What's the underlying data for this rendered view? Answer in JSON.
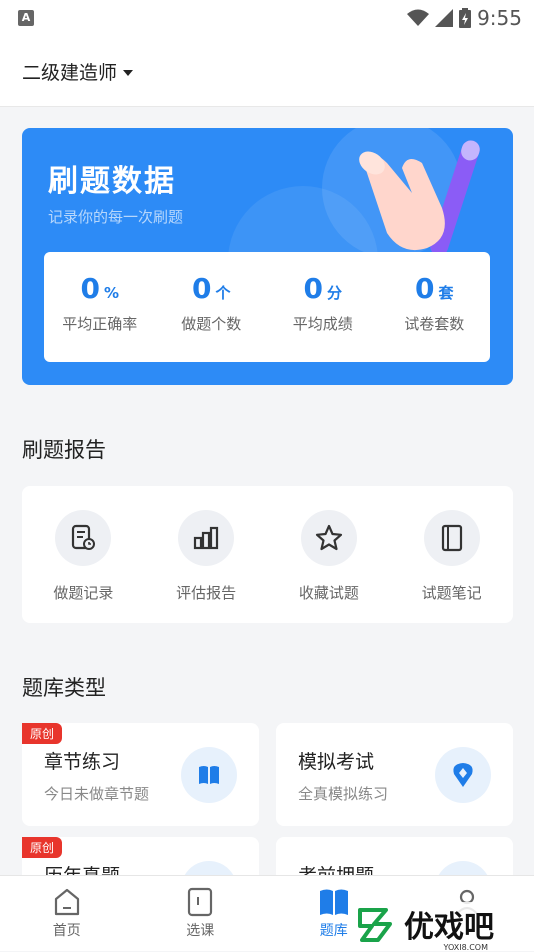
{
  "status_bar": {
    "time": "9:55",
    "left_badge": "A"
  },
  "header": {
    "subject": "二级建造师"
  },
  "banner": {
    "title": "刷题数据",
    "subtitle": "记录你的每一次刷题",
    "stats": [
      {
        "value": "0",
        "unit": "%",
        "label": "平均正确率"
      },
      {
        "value": "0",
        "unit": "个",
        "label": "做题个数"
      },
      {
        "value": "0",
        "unit": "分",
        "label": "平均成绩"
      },
      {
        "value": "0",
        "unit": "套",
        "label": "试卷套数"
      }
    ]
  },
  "report": {
    "title": "刷题报告",
    "items": [
      {
        "label": "做题记录",
        "icon": "record-icon"
      },
      {
        "label": "评估报告",
        "icon": "bar-chart-icon"
      },
      {
        "label": "收藏试题",
        "icon": "star-icon"
      },
      {
        "label": "试题笔记",
        "icon": "notebook-icon"
      }
    ]
  },
  "bank": {
    "title": "题库类型",
    "cards": [
      {
        "tag": "原创",
        "title": "章节练习",
        "subtitle": "今日未做章节题",
        "icon": "book-icon"
      },
      {
        "tag": "",
        "title": "模拟考试",
        "subtitle": "全真模拟练习",
        "icon": "location-pin-icon"
      },
      {
        "tag": "原创",
        "title": "历年真题",
        "subtitle": "",
        "icon": "paper-icon"
      },
      {
        "tag": "",
        "title": "考前押题",
        "subtitle": "",
        "icon": "target-icon"
      }
    ]
  },
  "tabbar": {
    "tabs": [
      {
        "label": "首页",
        "icon": "home-icon"
      },
      {
        "label": "选课",
        "icon": "course-icon"
      },
      {
        "label": "题库",
        "icon": "question-bank-icon"
      },
      {
        "label": "",
        "icon": "profile-icon"
      }
    ],
    "active_index": 2
  },
  "watermark": {
    "text": "优戏吧",
    "url": "YOXI8.COM"
  },
  "colors": {
    "primary": "#2d8bf6",
    "tag_red": "#e8352c"
  }
}
